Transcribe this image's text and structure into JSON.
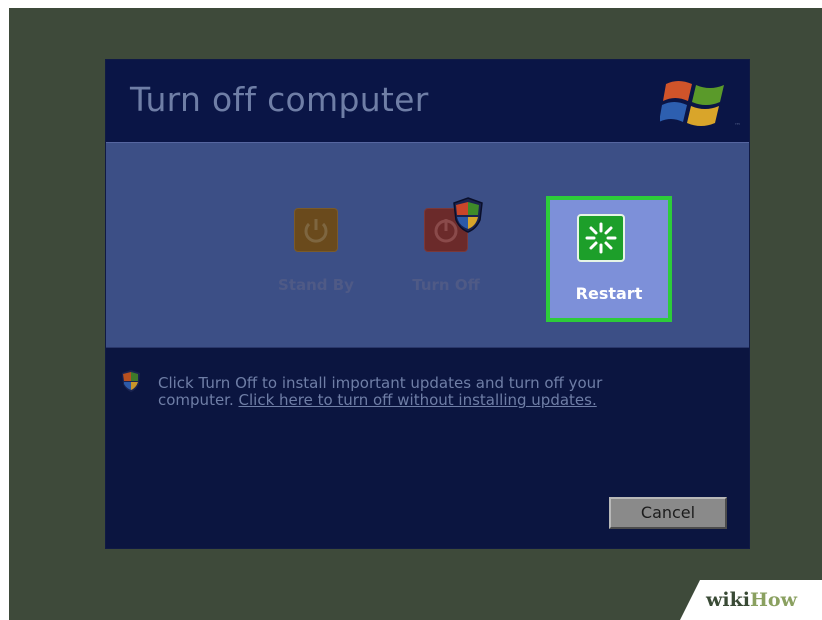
{
  "dialog": {
    "title": "Turn off computer"
  },
  "options": {
    "standby_label": "Stand By",
    "turnoff_label": "Turn Off",
    "restart_label": "Restart"
  },
  "message": {
    "text": "Click Turn Off to install important updates and turn off your computer.",
    "link": "Click here to turn off without installing updates."
  },
  "buttons": {
    "cancel_label": "Cancel"
  },
  "watermark": {
    "part1": "wiki",
    "part2": "How"
  },
  "colors": {
    "frame_bg": "#3e4a3a",
    "dialog_bg": "#0b1540",
    "band_bg": "#3c4f86",
    "restart_highlight": "#2dcc3a",
    "restart_bg": "#7d90d9"
  }
}
